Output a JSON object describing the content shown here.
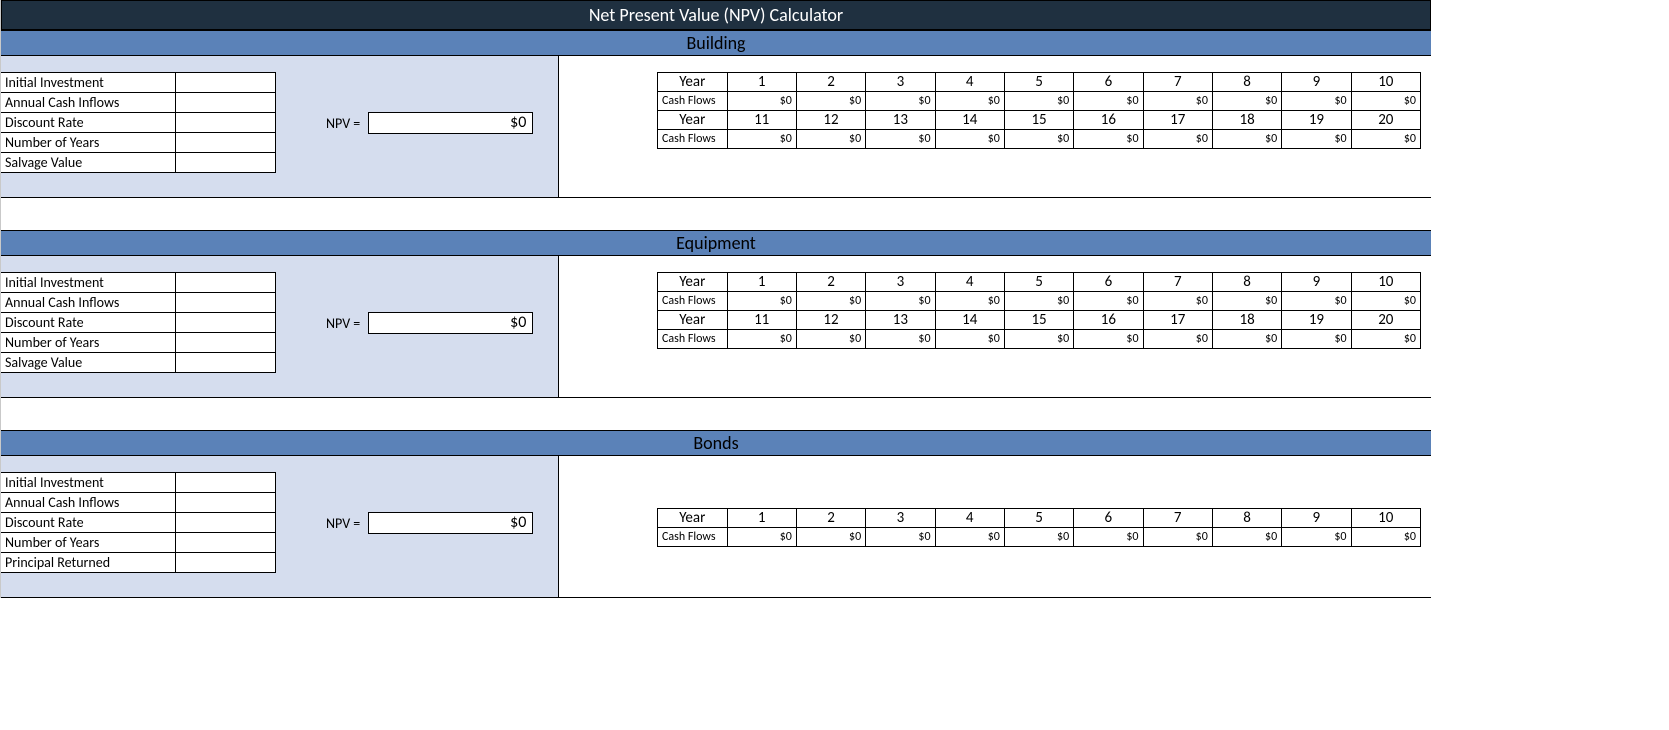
{
  "app": {
    "title": "Net Present Value (NPV) Calculator"
  },
  "sections": {
    "building": {
      "title": "Building",
      "inputs": {
        "l0": "Initial Investment",
        "l1": "Annual Cash Inflows",
        "l2": "Discount Rate",
        "l3": "Number of Years",
        "l4": "Salvage Value",
        "v0": "",
        "v1": "",
        "v2": "",
        "v3": "",
        "v4": ""
      },
      "npv_label": "NPV =",
      "npv_value": "$0",
      "cf": {
        "year_label": "Year",
        "cash_label": "Cash Flows",
        "row1_years": [
          "1",
          "2",
          "3",
          "4",
          "5",
          "6",
          "7",
          "8",
          "9",
          "10"
        ],
        "row1_vals": [
          "$0",
          "$0",
          "$0",
          "$0",
          "$0",
          "$0",
          "$0",
          "$0",
          "$0",
          "$0"
        ],
        "row2_years": [
          "11",
          "12",
          "13",
          "14",
          "15",
          "16",
          "17",
          "18",
          "19",
          "20"
        ],
        "row2_vals": [
          "$0",
          "$0",
          "$0",
          "$0",
          "$0",
          "$0",
          "$0",
          "$0",
          "$0",
          "$0"
        ]
      }
    },
    "equipment": {
      "title": "Equipment",
      "inputs": {
        "l0": "Initial Investment",
        "l1": "Annual Cash Inflows",
        "l2": "Discount Rate",
        "l3": "Number of Years",
        "l4": "Salvage Value",
        "v0": "",
        "v1": "",
        "v2": "",
        "v3": "",
        "v4": ""
      },
      "npv_label": "NPV =",
      "npv_value": "$0",
      "cf": {
        "year_label": "Year",
        "cash_label": "Cash Flows",
        "row1_years": [
          "1",
          "2",
          "3",
          "4",
          "5",
          "6",
          "7",
          "8",
          "9",
          "10"
        ],
        "row1_vals": [
          "$0",
          "$0",
          "$0",
          "$0",
          "$0",
          "$0",
          "$0",
          "$0",
          "$0",
          "$0"
        ],
        "row2_years": [
          "11",
          "12",
          "13",
          "14",
          "15",
          "16",
          "17",
          "18",
          "19",
          "20"
        ],
        "row2_vals": [
          "$0",
          "$0",
          "$0",
          "$0",
          "$0",
          "$0",
          "$0",
          "$0",
          "$0",
          "$0"
        ]
      }
    },
    "bonds": {
      "title": "Bonds",
      "inputs": {
        "l0": "Initial Investment",
        "l1": "Annual Cash Inflows",
        "l2": "Discount Rate",
        "l3": "Number of Years",
        "l4": "Principal Returned",
        "v0": "",
        "v1": "",
        "v2": "",
        "v3": "",
        "v4": ""
      },
      "npv_label": "NPV =",
      "npv_value": "$0",
      "cf": {
        "year_label": "Year",
        "cash_label": "Cash Flows",
        "row1_years": [
          "1",
          "2",
          "3",
          "4",
          "5",
          "6",
          "7",
          "8",
          "9",
          "10"
        ],
        "row1_vals": [
          "$0",
          "$0",
          "$0",
          "$0",
          "$0",
          "$0",
          "$0",
          "$0",
          "$0",
          "$0"
        ]
      }
    }
  }
}
